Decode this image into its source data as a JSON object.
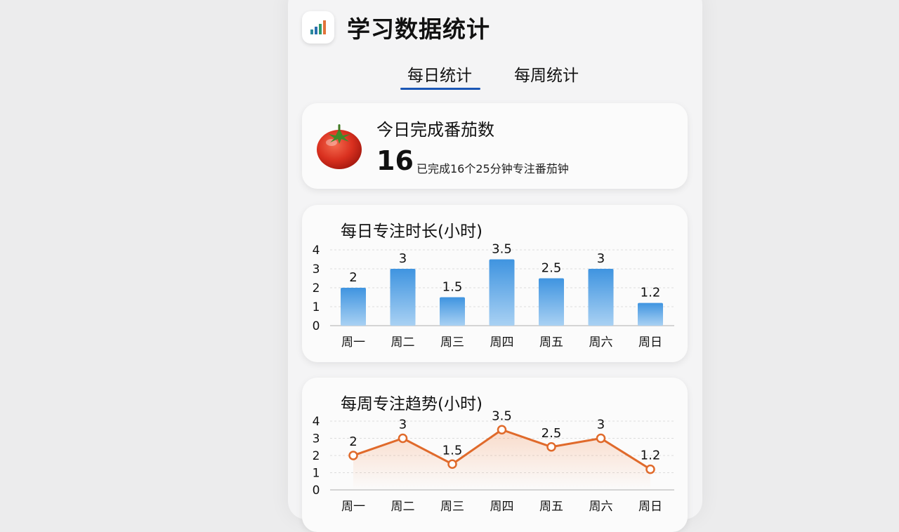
{
  "app": {
    "title": "学习数据统计",
    "icon": "bar-chart-icon"
  },
  "tabs": [
    {
      "label": "每日统计",
      "active": true
    },
    {
      "label": "每周统计",
      "active": false
    }
  ],
  "tomato": {
    "title": "今日完成番茄数",
    "count": "16",
    "description": "已完成16个25分钟专注番茄钟",
    "icon": "tomato-icon"
  },
  "colors": {
    "accent": "#1a56b5",
    "bar": "#5aa7e8",
    "line": "#e06a2b"
  },
  "chart_data": [
    {
      "type": "bar",
      "title": "每日专注时长(小时)",
      "categories": [
        "周一",
        "周二",
        "周三",
        "周四",
        "周五",
        "周六",
        "周日"
      ],
      "values": [
        2,
        3,
        1.5,
        3.5,
        2.5,
        3,
        1.2
      ],
      "value_labels": [
        "2",
        "3",
        "1.5",
        "3.5",
        "2.5",
        "3",
        "1.2"
      ],
      "yticks": [
        "0",
        "1",
        "2",
        "3",
        "4"
      ],
      "ylim": [
        0,
        4
      ],
      "grid": true
    },
    {
      "type": "line",
      "title": "每周专注趋势(小时)",
      "categories": [
        "周一",
        "周二",
        "周三",
        "周四",
        "周五",
        "周六",
        "周日"
      ],
      "values": [
        2,
        3,
        1.5,
        3.5,
        2.5,
        3,
        1.2
      ],
      "value_labels": [
        "2",
        "3",
        "1.5",
        "3.5",
        "2.5",
        "3",
        "1.2"
      ],
      "yticks": [
        "0",
        "1",
        "2",
        "3",
        "4"
      ],
      "ylim": [
        0,
        4
      ],
      "grid": true
    }
  ]
}
